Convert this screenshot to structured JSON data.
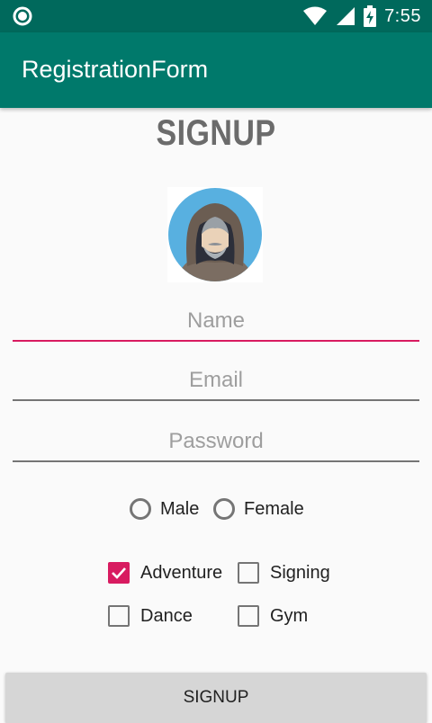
{
  "status_bar": {
    "time": "7:55",
    "icons": [
      "notification-circle-icon",
      "wifi-icon",
      "cell-signal-icon",
      "battery-charging-icon"
    ]
  },
  "app_bar": {
    "title": "RegistrationForm"
  },
  "form": {
    "heading": "SIGNUP",
    "avatar_icon": "hooded-person-avatar",
    "name_placeholder": "Name",
    "email_placeholder": "Email",
    "password_placeholder": "Password",
    "gender_options": [
      "Male",
      "Female"
    ],
    "hobbies": [
      {
        "label": "Adventure",
        "checked": true
      },
      {
        "label": "Signing",
        "checked": false
      },
      {
        "label": "Dance",
        "checked": false
      },
      {
        "label": "Gym",
        "checked": false
      }
    ],
    "submit_label": "SIGNUP"
  },
  "colors": {
    "status_bar": "#00695c",
    "app_bar": "#00796b",
    "accent": "#d81b60",
    "button": "#d6d6d6"
  }
}
